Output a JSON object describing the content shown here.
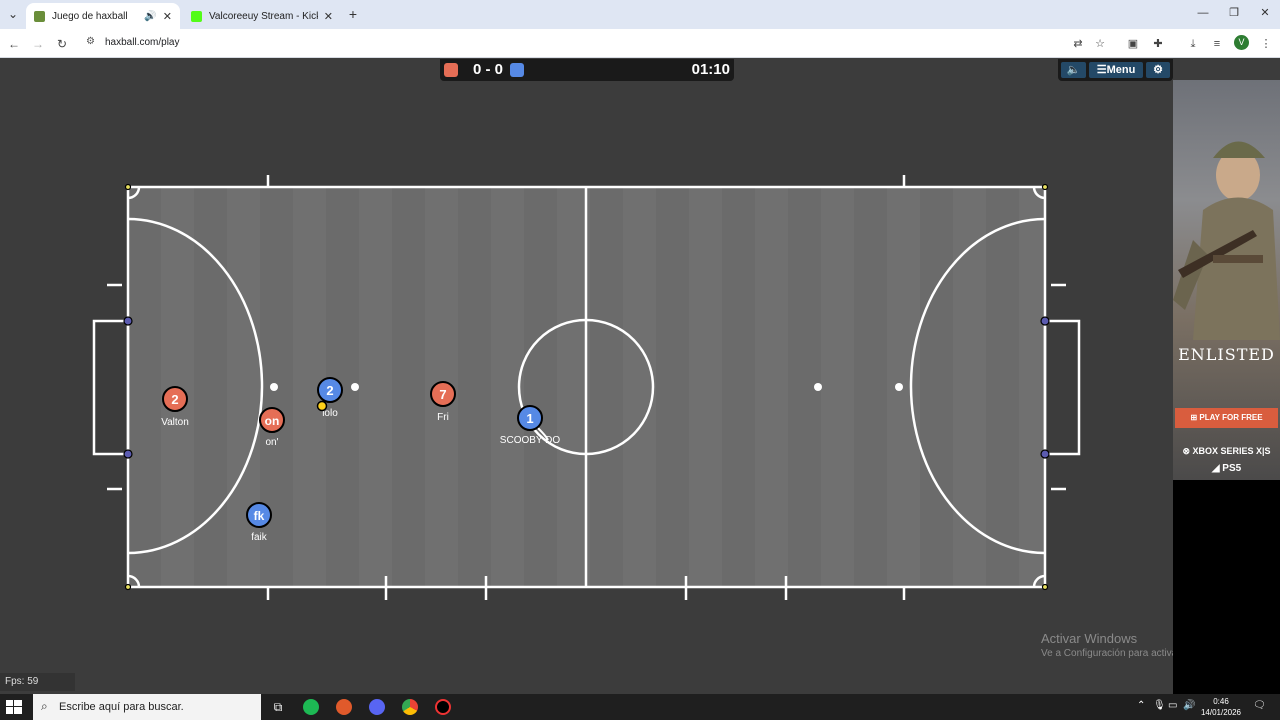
{
  "browser": {
    "tabs": [
      {
        "title": "Juego de haxball",
        "active": true,
        "favicon_color": "#6a8e3a"
      },
      {
        "title": "Valcoreeuy Stream - Kick Dashb",
        "active": false,
        "favicon_color": "#53fc18"
      }
    ],
    "new_tab_label": "+",
    "address": "haxball.com/play",
    "profile_initial": "V"
  },
  "game": {
    "score": "0 - 0",
    "timer": "01:10",
    "red_color": "#e56e56",
    "blue_color": "#5689e5",
    "menu_label": "Menu",
    "sound_icon": "speaker-icon",
    "settings_icon": "gear-icon",
    "fps_label": "Fps: 59",
    "players": [
      {
        "team": "red",
        "avatar": "2",
        "name": "Valton"
      },
      {
        "team": "red",
        "avatar": "on",
        "name": "on'"
      },
      {
        "team": "blue",
        "avatar": "2",
        "name": "lolo"
      },
      {
        "team": "red",
        "avatar": "7",
        "name": "Fri"
      },
      {
        "team": "blue",
        "avatar": "1",
        "name": "SCOOBY DO"
      },
      {
        "team": "blue",
        "avatar": "fk",
        "name": "faik"
      }
    ]
  },
  "ad": {
    "brand": "ENLISTED",
    "cta": "PLAY FOR FREE",
    "platform1": "XBOX SERIES X|S",
    "platform2": "PS5"
  },
  "watermark": {
    "title": "Activar Windows",
    "subtitle": "Ve a Configuración para activar Windows."
  },
  "taskbar": {
    "search_placeholder": "Escribe aquí para buscar.",
    "time": "0:46",
    "date": "14/01/2026"
  }
}
